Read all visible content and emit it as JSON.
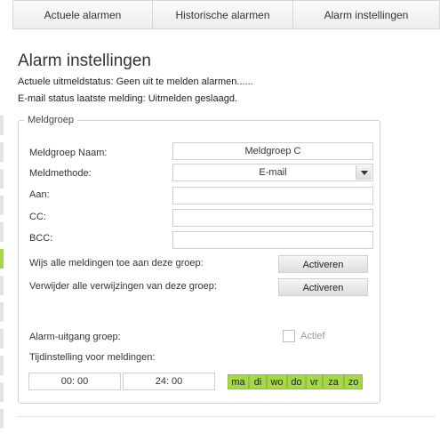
{
  "tabs": [
    "Actuele alarmen",
    "Historische alarmen",
    "Alarm instellingen"
  ],
  "page_title": "Alarm instellingen",
  "status": {
    "line1": "Actuele uitmeldstatus: Geen uit te melden alarmen......",
    "line2": "E-mail status laatste melding: Uitmelden geslaagd."
  },
  "group": {
    "legend": "Meldgroep",
    "name_label": "Meldgroep Naam:",
    "name_value": "Meldgroep C",
    "method_label": "Meldmethode:",
    "method_value": "E-mail",
    "to_label": "Aan:",
    "to_value": "",
    "cc_label": "CC:",
    "cc_value": "",
    "bcc_label": "BCC:",
    "bcc_value": "",
    "assign_label": "Wijs alle meldingen toe aan deze groep:",
    "assign_button": "Activeren",
    "remove_label": "Verwijder alle verwijzingen van deze groep:",
    "remove_button": "Activeren",
    "output_label": "Alarm-uitgang groep:",
    "active_label": "Actief",
    "timing_label": "Tijdinstelling voor meldingen:",
    "time_start": "00: 00",
    "time_end": "24: 00",
    "days": [
      "ma",
      "di",
      "wo",
      "do",
      "vr",
      "za",
      "zo"
    ]
  },
  "colors": {
    "day_active": "#a8d64a",
    "rail_active": "#a8d64a"
  }
}
